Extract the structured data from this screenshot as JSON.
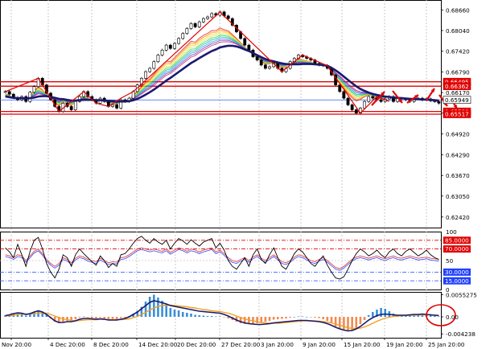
{
  "colors": {
    "background": "#ffffff",
    "axis_text": "#000000",
    "grid": "#c8c8c8",
    "candle_up": "#000000",
    "candle_body_up": "#ffffff",
    "ma_main": "#1a1a6e",
    "ribbon": [
      "#e31a1c",
      "#ff7f00",
      "#ffd700",
      "#b8e986",
      "#33cc33",
      "#1ab2b2",
      "#3399ff",
      "#6a3d9a",
      "#c71585"
    ],
    "hline_red": "#e00000",
    "hline_blue": "#3060ff",
    "zigzag": "#e00000",
    "label_red_bg": "#e00000",
    "label_blue_bg": "#2040ff",
    "label_white_bg": "#ffffff",
    "stoch_main": "#000000",
    "stoch_signal": "#9040c0",
    "rsi": "#e04040",
    "rsi_blue": "#3040ff",
    "macd_pos": "#3a8fd8",
    "macd_neg": "#f08a50",
    "macd_line": "#1a1a6e",
    "macd_signal": "#f0a020",
    "circle": "#e00000",
    "arrow": "#e00000"
  },
  "chart_data": [
    {
      "type": "line",
      "panel": "price",
      "x_ticks": [
        "Nov 20:00",
        "4 Dec 20:00",
        "8 Dec 20:00",
        "14 Dec 20:00",
        "20 Dec 20:00",
        "27 Dec 20:00",
        "3 Jan 20:00",
        "9 Jan 20:00",
        "15 Jan 20:00",
        "19 Jan 20:00",
        "25 Jan 20:00"
      ],
      "y_ticks": [
        "0.68660",
        "0.68040",
        "0.67420",
        "0.66790",
        "0.66170",
        "0.65549",
        "0.64920",
        "0.64290",
        "0.63670",
        "0.63050",
        "0.62420"
      ],
      "ylim": [
        0.621,
        0.6896
      ],
      "price_labels": [
        {
          "value": 0.66495,
          "text": "0.66495",
          "style": "red"
        },
        {
          "value": 0.66362,
          "text": "0.66362",
          "style": "red"
        },
        {
          "value": 0.65949,
          "text": "0.65949",
          "style": "white"
        },
        {
          "value": 0.65599,
          "text": "0.65599",
          "style": "red"
        },
        {
          "value": 0.65517,
          "text": "0.65517",
          "style": "red"
        }
      ],
      "horizontal_lines": [
        {
          "value": 0.66495,
          "color": "red"
        },
        {
          "value": 0.66362,
          "color": "red"
        },
        {
          "value": 0.65949,
          "color": "blue"
        },
        {
          "value": 0.65599,
          "color": "red"
        },
        {
          "value": 0.65517,
          "color": "red"
        }
      ],
      "close": [
        0.662,
        0.6612,
        0.6602,
        0.6595,
        0.6605,
        0.659,
        0.6618,
        0.6635,
        0.666,
        0.664,
        0.6615,
        0.6595,
        0.6575,
        0.656,
        0.6585,
        0.6575,
        0.6565,
        0.659,
        0.6605,
        0.662,
        0.6605,
        0.6595,
        0.6585,
        0.66,
        0.659,
        0.6575,
        0.658,
        0.657,
        0.6595,
        0.659,
        0.66,
        0.662,
        0.664,
        0.666,
        0.668,
        0.669,
        0.671,
        0.673,
        0.6745,
        0.676,
        0.675,
        0.6765,
        0.678,
        0.6795,
        0.681,
        0.6825,
        0.6815,
        0.683,
        0.684,
        0.6845,
        0.6855,
        0.685,
        0.686,
        0.6848,
        0.684,
        0.682,
        0.68,
        0.678,
        0.676,
        0.6745,
        0.6725,
        0.6715,
        0.67,
        0.669,
        0.6695,
        0.6705,
        0.669,
        0.668,
        0.669,
        0.671,
        0.672,
        0.673,
        0.6725,
        0.672,
        0.6715,
        0.6705,
        0.67,
        0.6698,
        0.669,
        0.667,
        0.664,
        0.662,
        0.66,
        0.658,
        0.6565,
        0.6555,
        0.657,
        0.659,
        0.6605,
        0.66,
        0.6595,
        0.659,
        0.6598,
        0.6605,
        0.659,
        0.66,
        0.6598,
        0.6595,
        0.659,
        0.6598,
        0.66,
        0.6595,
        0.6598,
        0.6592,
        0.659,
        0.6585
      ],
      "ma_main": [
        0.6605,
        0.6603,
        0.6601,
        0.66,
        0.66,
        0.6599,
        0.66,
        0.6602,
        0.6605,
        0.6606,
        0.6606,
        0.6604,
        0.6601,
        0.6598,
        0.6597,
        0.6595,
        0.6593,
        0.6593,
        0.6594,
        0.6595,
        0.6595,
        0.6595,
        0.6594,
        0.6594,
        0.6593,
        0.6592,
        0.6591,
        0.659,
        0.659,
        0.659,
        0.6591,
        0.6594,
        0.6598,
        0.6604,
        0.6611,
        0.6618,
        0.6626,
        0.6635,
        0.6644,
        0.6653,
        0.6661,
        0.667,
        0.6679,
        0.6688,
        0.6697,
        0.6706,
        0.6713,
        0.6721,
        0.6728,
        0.6735,
        0.6742,
        0.6747,
        0.6753,
        0.6756,
        0.6758,
        0.6758,
        0.6756,
        0.6752,
        0.6747,
        0.6742,
        0.6736,
        0.673,
        0.6724,
        0.6718,
        0.6714,
        0.6711,
        0.6708,
        0.6705,
        0.6703,
        0.6702,
        0.6702,
        0.6702,
        0.6703,
        0.6703,
        0.6703,
        0.6702,
        0.6701,
        0.67,
        0.6698,
        0.6692,
        0.6684,
        0.6675,
        0.6665,
        0.6655,
        0.6645,
        0.6636,
        0.6628,
        0.6622,
        0.6617,
        0.6613,
        0.661,
        0.6607,
        0.6605,
        0.6604,
        0.6602,
        0.6601,
        0.66,
        0.6599,
        0.6598,
        0.6597,
        0.6597,
        0.6596,
        0.6596,
        0.6595,
        0.6594,
        0.6593
      ],
      "zigzag": [
        [
          0,
          0.662
        ],
        [
          8,
          0.666
        ],
        [
          13,
          0.656
        ],
        [
          19,
          0.662
        ],
        [
          22,
          0.6585
        ],
        [
          25,
          0.6575
        ],
        [
          28,
          0.66
        ],
        [
          31,
          0.662
        ],
        [
          52,
          0.686
        ],
        [
          67,
          0.668
        ],
        [
          72,
          0.673
        ],
        [
          78,
          0.6698
        ],
        [
          86,
          0.6555
        ],
        [
          90,
          0.6605
        ],
        [
          93,
          0.659
        ]
      ]
    },
    {
      "type": "line",
      "panel": "oscillator",
      "y_ticks": [
        "100",
        "85.0000",
        "70.0000",
        "50",
        "30.0000",
        "15.0000",
        "0"
      ],
      "levels": [
        {
          "value": 85,
          "color": "red",
          "label": true
        },
        {
          "value": 70,
          "color": "red",
          "label": true
        },
        {
          "value": 30,
          "color": "blue",
          "label": true
        },
        {
          "value": 15,
          "color": "blue",
          "label": true
        }
      ],
      "ylim": [
        0,
        100
      ],
      "stoch": [
        72,
        65,
        55,
        78,
        60,
        40,
        66,
        85,
        90,
        70,
        45,
        30,
        20,
        35,
        60,
        55,
        40,
        60,
        70,
        62,
        55,
        48,
        42,
        58,
        50,
        38,
        45,
        40,
        60,
        62,
        70,
        80,
        88,
        92,
        85,
        80,
        88,
        82,
        78,
        85,
        70,
        80,
        88,
        84,
        78,
        86,
        80,
        75,
        82,
        85,
        88,
        72,
        80,
        68,
        50,
        40,
        35,
        45,
        55,
        40,
        60,
        70,
        52,
        45,
        60,
        72,
        55,
        40,
        35,
        48,
        62,
        70,
        65,
        55,
        45,
        40,
        50,
        58,
        42,
        30,
        20,
        18,
        22,
        35,
        50,
        62,
        70,
        65,
        58,
        62,
        68,
        60,
        55,
        65,
        70,
        62,
        58,
        66,
        70,
        64,
        58,
        62,
        68,
        60,
        55,
        52
      ],
      "rsi": [
        60,
        58,
        55,
        60,
        58,
        50,
        58,
        66,
        70,
        62,
        52,
        45,
        40,
        45,
        55,
        52,
        46,
        54,
        58,
        56,
        52,
        50,
        48,
        54,
        50,
        46,
        48,
        47,
        55,
        56,
        60,
        65,
        70,
        72,
        70,
        68,
        70,
        68,
        66,
        70,
        64,
        68,
        72,
        70,
        66,
        70,
        68,
        65,
        68,
        70,
        72,
        65,
        68,
        62,
        55,
        50,
        48,
        52,
        55,
        50,
        56,
        60,
        54,
        50,
        55,
        60,
        54,
        48,
        46,
        50,
        56,
        60,
        58,
        54,
        50,
        48,
        52,
        55,
        50,
        44,
        38,
        36,
        40,
        46,
        52,
        56,
        58,
        56,
        54,
        56,
        58,
        55,
        53,
        56,
        58,
        55,
        54,
        56,
        58,
        56,
        54,
        55,
        56,
        54,
        53,
        52
      ]
    },
    {
      "type": "bar",
      "panel": "macd",
      "y_ticks": [
        "0.0055275",
        "0.00",
        "-0.004238"
      ],
      "ylim": [
        -0.0052,
        0.0062
      ],
      "histogram": [
        0.0004,
        0.0006,
        0.0008,
        0.001,
        0.0007,
        0.0003,
        0.0006,
        0.0012,
        0.0016,
        0.0012,
        0.0005,
        -0.0004,
        -0.0012,
        -0.0016,
        -0.0012,
        -0.001,
        -0.0011,
        -0.0006,
        -0.0002,
        0.0001,
        -0.0001,
        -0.0003,
        -0.0004,
        -0.0002,
        -0.0004,
        -0.0006,
        -0.0005,
        -0.0006,
        -0.0003,
        -0.0002,
        0.0002,
        0.0008,
        0.0015,
        0.0025,
        0.0038,
        0.005,
        0.0055,
        0.0048,
        0.004,
        0.0032,
        0.0022,
        0.0018,
        0.0016,
        0.0012,
        0.001,
        0.0008,
        0.0005,
        0.0004,
        0.0003,
        0.0002,
        0.0002,
        0.0001,
        0.0001,
        -0.0001,
        -0.0004,
        -0.0008,
        -0.0012,
        -0.0016,
        -0.0018,
        -0.0018,
        -0.0017,
        -0.0016,
        -0.0014,
        -0.0012,
        -0.001,
        -0.0007,
        -0.0006,
        -0.0005,
        -0.0004,
        -0.0002,
        0.0,
        0.0001,
        0.0001,
        0.0,
        -0.0001,
        -0.0002,
        -0.0003,
        -0.0006,
        -0.001,
        -0.0016,
        -0.0024,
        -0.003,
        -0.0034,
        -0.0036,
        -0.0034,
        -0.0028,
        -0.0018,
        -0.0008,
        0.0004,
        0.0012,
        0.0018,
        0.0022,
        0.002,
        0.0014,
        0.0008,
        0.0004,
        0.0003,
        0.0002,
        0.0003,
        0.0004,
        0.0005,
        0.0006,
        0.0005,
        0.0004,
        0.0002,
        0.0001
      ],
      "macd_line": [
        0.0003,
        0.0005,
        0.0008,
        0.001,
        0.0009,
        0.0006,
        0.0008,
        0.0012,
        0.0015,
        0.0012,
        0.0006,
        -0.0002,
        -0.001,
        -0.0014,
        -0.0014,
        -0.0012,
        -0.0012,
        -0.001,
        -0.0006,
        -0.0004,
        -0.0004,
        -0.0005,
        -0.0006,
        -0.0005,
        -0.0006,
        -0.0008,
        -0.0008,
        -0.0008,
        -0.0006,
        -0.0004,
        0.0,
        0.0006,
        0.0012,
        0.002,
        0.0028,
        0.0036,
        0.004,
        0.0038,
        0.0035,
        0.0032,
        0.0028,
        0.0026,
        0.0024,
        0.0022,
        0.002,
        0.0018,
        0.0016,
        0.0014,
        0.0013,
        0.0012,
        0.0011,
        0.001,
        0.0009,
        0.0006,
        0.0002,
        -0.0003,
        -0.0008,
        -0.0012,
        -0.0015,
        -0.0017,
        -0.0018,
        -0.0019,
        -0.0019,
        -0.0018,
        -0.0017,
        -0.0015,
        -0.0014,
        -0.0013,
        -0.0012,
        -0.0011,
        -0.001,
        -0.0009,
        -0.0009,
        -0.0009,
        -0.001,
        -0.0011,
        -0.0012,
        -0.0014,
        -0.0017,
        -0.0021,
        -0.0026,
        -0.003,
        -0.0033,
        -0.0035,
        -0.0034,
        -0.003,
        -0.0024,
        -0.0016,
        -0.0008,
        -0.0002,
        0.0003,
        0.0006,
        0.0007,
        0.0006,
        0.0005,
        0.0004,
        0.0004,
        0.0004,
        0.0005,
        0.0006,
        0.0006,
        0.0007,
        0.0006,
        0.0005,
        0.0004,
        0.0003
      ],
      "signal_line": [
        0.0002,
        0.0003,
        0.0004,
        0.0006,
        0.0007,
        0.0007,
        0.0007,
        0.0008,
        0.0009,
        0.001,
        0.0009,
        0.0006,
        0.0002,
        -0.0002,
        -0.0005,
        -0.0007,
        -0.0009,
        -0.001,
        -0.0009,
        -0.0008,
        -0.0007,
        -0.0007,
        -0.0007,
        -0.0006,
        -0.0006,
        -0.0007,
        -0.0007,
        -0.0007,
        -0.0007,
        -0.0006,
        -0.0005,
        -0.0002,
        0.0001,
        0.0006,
        0.0011,
        0.0017,
        0.0022,
        0.0026,
        0.0028,
        0.0029,
        0.0029,
        0.0028,
        0.0027,
        0.0026,
        0.0025,
        0.0023,
        0.0022,
        0.002,
        0.0018,
        0.0017,
        0.0015,
        0.0014,
        0.0013,
        0.0011,
        0.0009,
        0.0006,
        0.0002,
        -0.0002,
        -0.0005,
        -0.0008,
        -0.001,
        -0.0012,
        -0.0014,
        -0.0015,
        -0.0016,
        -0.0016,
        -0.0016,
        -0.0015,
        -0.0014,
        -0.0013,
        -0.0012,
        -0.0011,
        -0.001,
        -0.001,
        -0.001,
        -0.001,
        -0.0011,
        -0.0012,
        -0.0013,
        -0.0015,
        -0.0018,
        -0.0021,
        -0.0024,
        -0.0027,
        -0.0029,
        -0.0029,
        -0.0028,
        -0.0025,
        -0.0021,
        -0.0016,
        -0.0011,
        -0.0007,
        -0.0003,
        -0.0001,
        0.0001,
        0.0002,
        0.0003,
        0.0003,
        0.0004,
        0.0004,
        0.0005,
        0.0005,
        0.0005,
        0.0005,
        0.0004,
        0.0004
      ]
    }
  ]
}
